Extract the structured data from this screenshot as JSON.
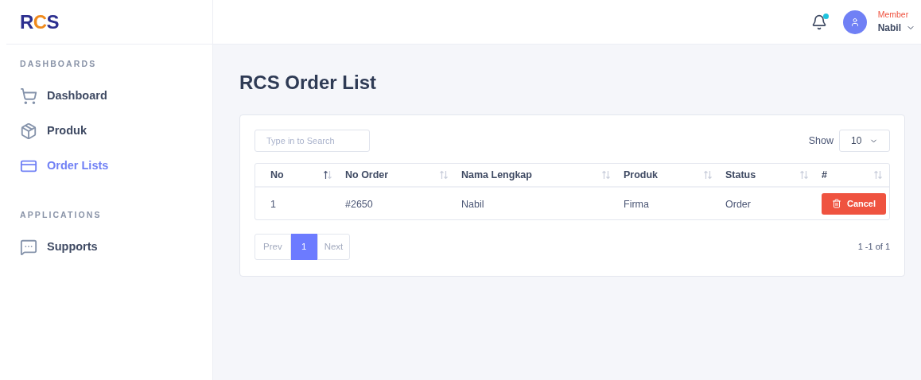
{
  "logo": "RCS",
  "header": {
    "notification_dot": true,
    "role": "Member",
    "user": "Nabil"
  },
  "sidebar": {
    "sections": [
      {
        "title": "DASHBOARDS",
        "items": [
          {
            "label": "Dashboard",
            "selected": false
          },
          {
            "label": "Produk",
            "selected": false
          },
          {
            "label": "Order Lists",
            "selected": true
          }
        ]
      },
      {
        "title": "APPLICATIONS",
        "items": [
          {
            "label": "Supports",
            "selected": false
          }
        ]
      }
    ]
  },
  "page_title": "RCS Order List",
  "search": {
    "placeholder": "Type in to Search"
  },
  "show": {
    "label": "Show",
    "value": "10"
  },
  "table": {
    "columns": [
      {
        "label": "No",
        "sorted": true
      },
      {
        "label": "No Order",
        "sorted": false
      },
      {
        "label": "Nama Lengkap",
        "sorted": false
      },
      {
        "label": "Produk",
        "sorted": false
      },
      {
        "label": "Status",
        "sorted": false
      },
      {
        "label": "#",
        "sorted": false
      }
    ],
    "rows": [
      {
        "cells": [
          "1",
          "#2650",
          "Nabil",
          "Firma",
          "Order"
        ],
        "action": "Cancel"
      }
    ]
  },
  "pagination": {
    "prev": "Prev",
    "pages": [
      {
        "label": "1",
        "selected": true
      }
    ],
    "next": "Next",
    "summary": "1 -1 of 1"
  }
}
